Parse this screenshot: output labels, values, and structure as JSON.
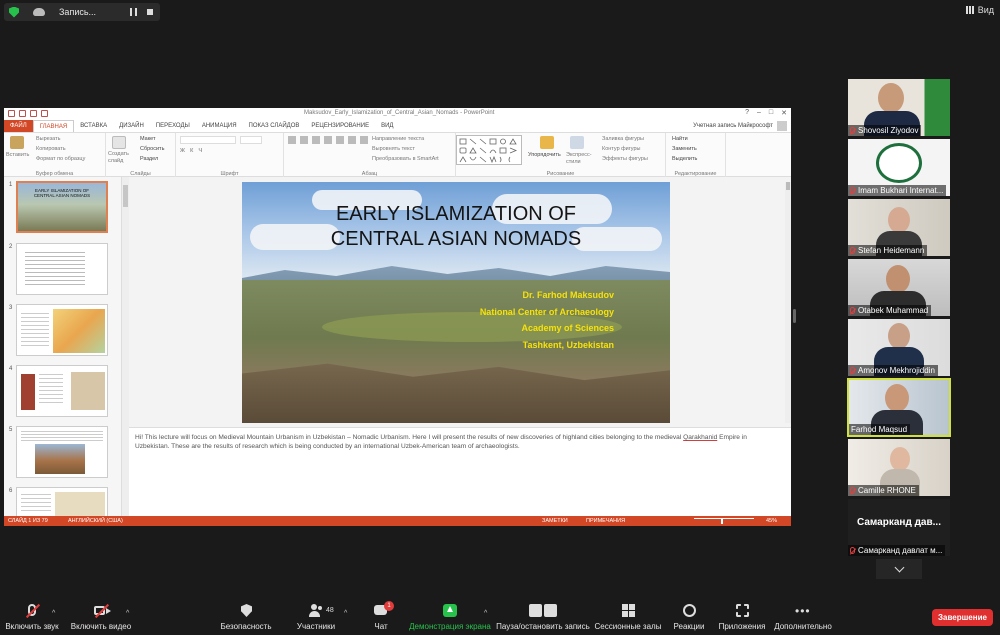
{
  "top": {
    "recording_label": "Запись...",
    "view_label": "Вид"
  },
  "ppt": {
    "window_title": "Maksudov_Early_Islamization_of_Central_Asian_Nomads - PowerPoint",
    "window_controls": [
      "?",
      "–",
      "□",
      "✕"
    ],
    "tabs": [
      "ФАЙЛ",
      "ГЛАВНАЯ",
      "ВСТАВКА",
      "ДИЗАЙН",
      "ПЕРЕХОДЫ",
      "АНИМАЦИЯ",
      "ПОКАЗ СЛАЙДОВ",
      "РЕЦЕНЗИРОВАНИЕ",
      "ВИД"
    ],
    "account": "Учетная запись Майкрософт",
    "ribbon": {
      "groups": [
        "Буфер обмена",
        "Слайды",
        "Шрифт",
        "Абзац",
        "Рисование",
        "Редактирование"
      ],
      "paste": "Вставить",
      "cut": "Вырезать",
      "copy": "Копировать",
      "format_painter": "Формат по образцу",
      "create_slide": "Создать слайд",
      "layout": "Макет",
      "reset": "Сбросить",
      "section": "Раздел",
      "text_direction": "Направление текста",
      "align_text": "Выровнять текст",
      "smartart": "Преобразовать в SmartArt",
      "arrange": "Упорядочить",
      "quick_styles": "Экспресс-стили",
      "shape_fill": "Заливка фигуры",
      "shape_outline": "Контур фигуры",
      "shape_effects": "Эффекты фигуры",
      "find": "Найти",
      "replace": "Заменить",
      "select": "Выделить"
    },
    "thumb_numbers": [
      "1",
      "2",
      "3",
      "4",
      "5",
      "6"
    ],
    "thumb1_title": "EARLY ISLAMIZATION OF CENTRAL ASIAN NOMADS",
    "slide": {
      "title_line1": "EARLY ISLAMIZATION OF",
      "title_line2": "CENTRAL ASIAN NOMADS",
      "author_lines": [
        "Dr. Farhod Maksudov",
        "National Center of Archaeology",
        "Academy of Sciences",
        "Tashkent, Uzbekistan"
      ]
    },
    "notes": {
      "part1": "Hi! This lecture will focus on Medieval Mountain Urbanism in Uzbekistan – Nomadic Urbanism. Here I will present the results of new discoveries of highland cities belonging to the medieval ",
      "underlined": "Qarakhanid",
      "part2": " Empire in Uzbekistan. These are the results of research which is being conducted by an international Uzbek-American team of archaeologists."
    },
    "status": {
      "slide_info": "СЛАЙД 1 ИЗ 79",
      "language": "АНГЛИЙСКИЙ (США)",
      "notes": "ЗАМЕТКИ",
      "comments": "ПРИМЕЧАНИЯ",
      "zoom": "45%"
    }
  },
  "participants": [
    {
      "name": "Shovosil Ziyodov"
    },
    {
      "name": "Imam Bukhari Internat..."
    },
    {
      "name": "Stefan Heidemann"
    },
    {
      "name": "Otabek Muhammad"
    },
    {
      "name": "Amonov Mekhrojiddin"
    },
    {
      "name": "Farhod Maqsud"
    },
    {
      "name": "Camille RHONE"
    },
    {
      "name": "Самарканд давлат м...",
      "display": "Самарканд дав..."
    }
  ],
  "toolbar": {
    "mute": "Включить звук",
    "video": "Включить видео",
    "security": "Безопасность",
    "participants": "Участники",
    "participants_count": "48",
    "chat": "Чат",
    "chat_badge": "1",
    "share": "Демонстрация экрана",
    "pause_record": "Пауза/остановить запись",
    "rooms": "Сессионные залы",
    "reactions": "Реакции",
    "apps": "Приложения",
    "more": "Дополнительно",
    "end": "Завершение"
  },
  "colors": {
    "ppt_accent": "#d24726",
    "speaker_border": "#cfe13a",
    "end_button": "#e02f2f",
    "share_green": "#27c24c",
    "author_text": "#f6e20a"
  }
}
